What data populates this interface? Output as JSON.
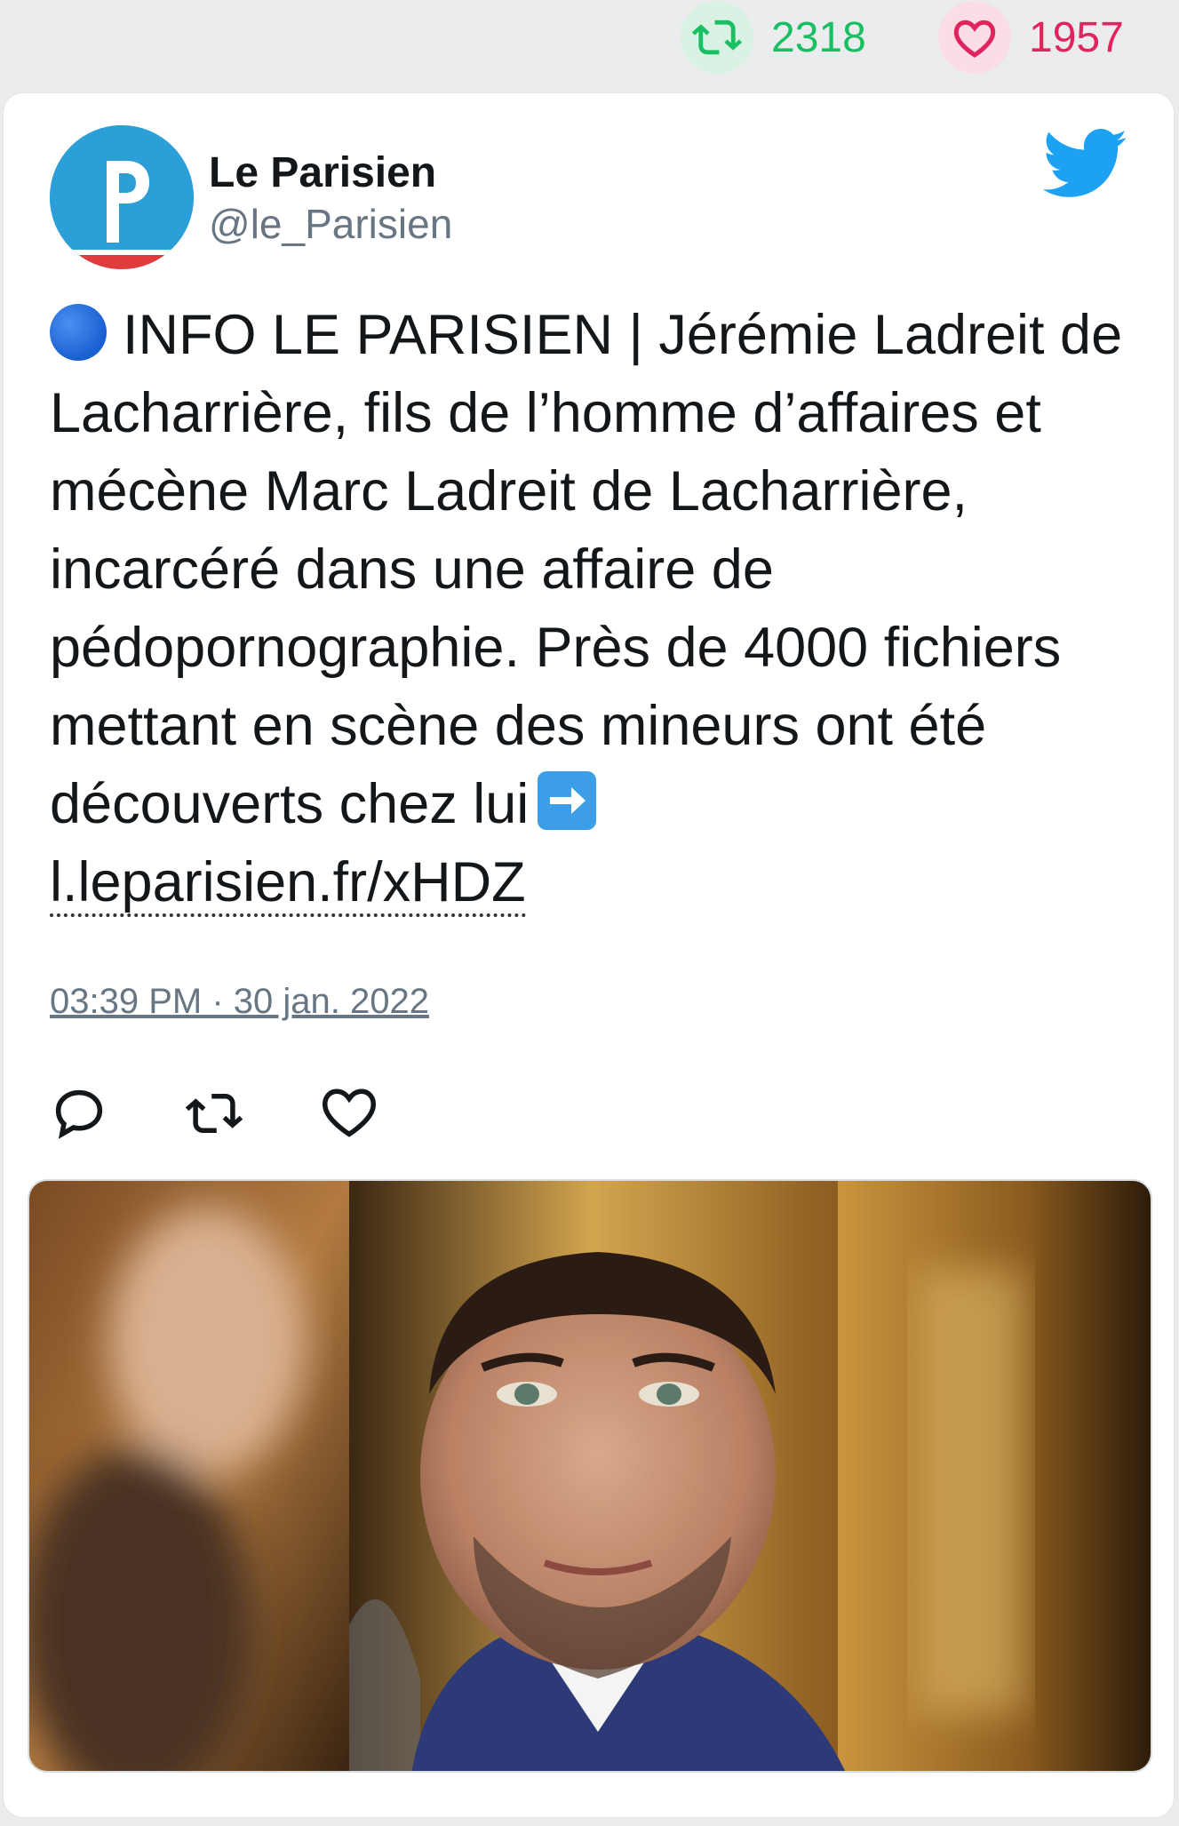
{
  "stats": {
    "retweets": "2318",
    "likes": "1957"
  },
  "author": {
    "name": "Le Parisien",
    "handle": "@le_Parisien",
    "avatar_letter": "P"
  },
  "tweet": {
    "text_main": "INFO LE PARISIEN | Jérémie Ladreit de Lacharrière, fils de l’homme d’affaires et mécène Marc Ladreit de Lacharrière, incarcéré dans une affaire de pédopornographie. Près de 4000 fichiers mettant en scène des mineurs ont été découverts chez lui",
    "link": "l.leparisien.fr/xHDZ",
    "timestamp": "03:39 PM · 30 jan. 2022"
  },
  "icons": {
    "retweet": "retweet-icon",
    "like": "heart-icon",
    "reply": "reply-icon",
    "brand": "twitter-bird-icon",
    "marker": "blue-circle-icon",
    "arrow": "right-arrow-icon"
  },
  "colors": {
    "retweet_green": "#19bf63",
    "like_red": "#e0245e",
    "twitter_blue": "#1da1f2",
    "text_dark": "#14171a",
    "text_gray": "#687684",
    "avatar_blue": "#2d9fd8"
  }
}
